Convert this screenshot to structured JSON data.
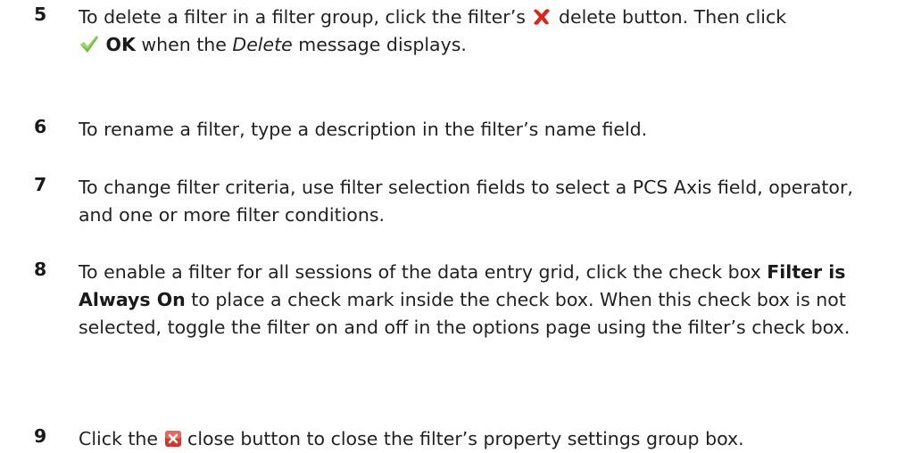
{
  "steps": [
    {
      "number": "5",
      "parts": [
        "To delete a filter in a filter group, click the filter’s ",
        " delete button. Then click",
        "OK",
        " when the ",
        "Delete",
        " message displays."
      ],
      "icons": [
        "delete-x-icon",
        "checkmark-icon"
      ]
    },
    {
      "number": "6",
      "text": "To rename a filter, type a description in the filter’s name field."
    },
    {
      "number": "7",
      "text": "To change filter criteria, use filter selection fields to select a PCS Axis field, operator, and one or more filter conditions."
    },
    {
      "number": "8",
      "parts": [
        "To enable a filter for all sessions of the data entry grid, click the check box ",
        "Filter is Always On",
        " to place a check mark inside the check box. When this check box is not selected, toggle the filter on and off in the options page using the filter’s check box."
      ]
    },
    {
      "number": "9",
      "parts": [
        "Click the ",
        " close button to close the filter’s property settings group box."
      ],
      "icons": [
        "close-box-icon"
      ]
    }
  ],
  "colors": {
    "delete_x": "#d9261c",
    "checkmark": "#6cbf3a",
    "close_box": "#d8332b"
  }
}
